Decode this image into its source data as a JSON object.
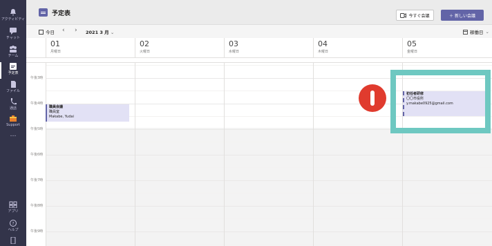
{
  "rail": {
    "items": [
      {
        "label": "アクティビティ",
        "icon": "bell-icon"
      },
      {
        "label": "チャット",
        "icon": "chat-icon"
      },
      {
        "label": "チーム",
        "icon": "teams-icon"
      },
      {
        "label": "予定表",
        "icon": "calendar-icon",
        "active": true
      },
      {
        "label": "ファイル",
        "icon": "file-icon"
      },
      {
        "label": "通話",
        "icon": "phone-icon"
      },
      {
        "label": "Support",
        "icon": "support-icon"
      },
      {
        "label": "…",
        "icon": "more-icon"
      }
    ],
    "bottom": [
      {
        "label": "アプリ",
        "icon": "apps-icon"
      },
      {
        "label": "ヘルプ",
        "icon": "help-icon"
      }
    ]
  },
  "header": {
    "title": "予定表",
    "meet_now": "今すぐ会議",
    "new_meeting": "＋ 新しい会議"
  },
  "toolbar": {
    "today": "今日",
    "month": "2021 3 月",
    "view": "稼働日"
  },
  "days": [
    {
      "num": "01",
      "name": "月曜日"
    },
    {
      "num": "02",
      "name": "火曜日"
    },
    {
      "num": "03",
      "name": "水曜日"
    },
    {
      "num": "04",
      "name": "木曜日"
    },
    {
      "num": "05",
      "name": "金曜日"
    }
  ],
  "times": [
    "午後3時",
    "午後4時",
    "午後5時",
    "午後6時",
    "午後7時",
    "午後8時",
    "午後9時"
  ],
  "events": [
    {
      "title": "職員会議",
      "lines": [
        "職員室",
        "Makabe, Yudai"
      ]
    },
    {
      "title": "初任者研修",
      "lines": [
        "〇〇市役所",
        "y.makabe0925@gmail.com"
      ]
    }
  ],
  "annotation": {
    "step": "1",
    "color": "#e03b2e",
    "frame_color": "#6ec8c1"
  },
  "colors": {
    "accent": "#6264a7",
    "rail": "#33344a"
  }
}
